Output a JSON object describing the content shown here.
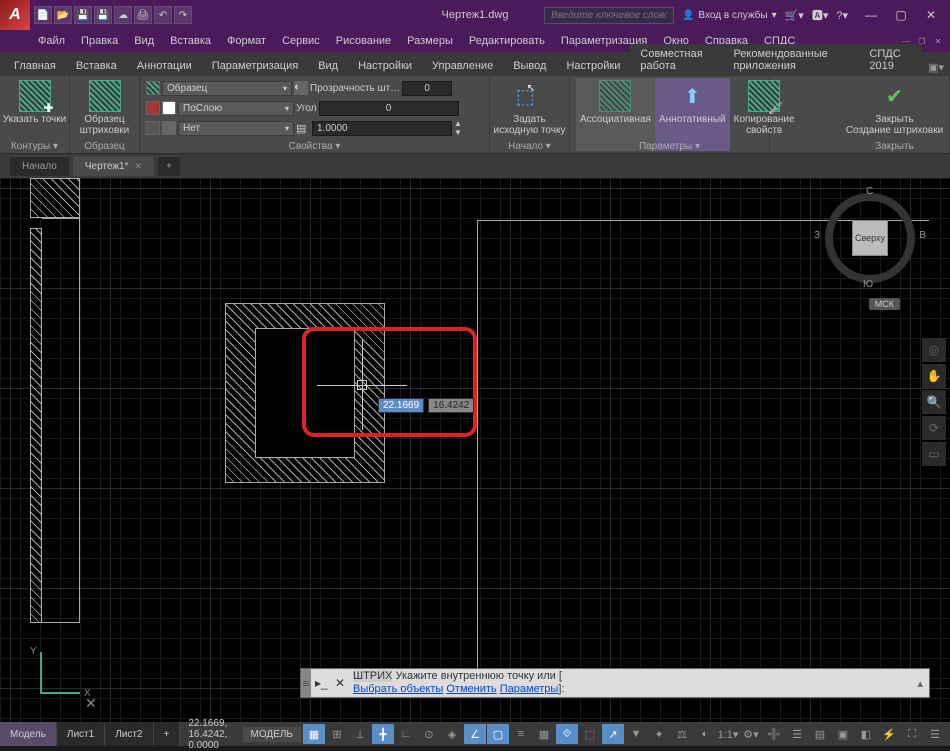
{
  "title": "Чертеж1.dwg",
  "search_placeholder": "Введите ключевое слово/фразу",
  "signin": "Вход в службы",
  "menu": [
    "Файл",
    "Правка",
    "Вид",
    "Вставка",
    "Формат",
    "Сервис",
    "Рисование",
    "Размеры",
    "Редактировать",
    "Параметризация",
    "Окно",
    "Справка",
    "СПДС"
  ],
  "ribbon_tabs": [
    "Главная",
    "Вставка",
    "Аннотации",
    "Параметризация",
    "Вид",
    "Настройки",
    "Управление",
    "Вывод",
    "Настройки",
    "Совместная работа",
    "Рекомендованные приложения",
    "СПДС 2019"
  ],
  "ribbon": {
    "contours": {
      "label": "Контуры ▾",
      "btn": "Указать точки"
    },
    "pattern": {
      "label": "Образец",
      "btn": "Образец\nштриховки"
    },
    "props": {
      "label": "Свойства ▾",
      "pattern": "Образец",
      "bylayer": "ПоСлою",
      "none": "Нет",
      "transp": "Прозрачность шт…",
      "transp_val": "0",
      "angle": "Угол",
      "angle_val": "0",
      "scale_val": "1.0000"
    },
    "origin": {
      "label": "Начало ▾",
      "btn": "Задать\nисходную точку"
    },
    "options": {
      "label": "Параметры ▾",
      "assoc": "Ассоциативная",
      "annot": "Аннотативный",
      "match": "Копирование\nсвойств"
    },
    "close": {
      "label": "Закрыть",
      "btn": "Закрыть\nСоздание штриховки"
    }
  },
  "filetabs": {
    "start": "Начало",
    "current": "Чертеж1*"
  },
  "cursor": {
    "x": "22.1669",
    "y": "16.4242"
  },
  "viewcube": {
    "face": "Сверху",
    "n": "С",
    "s": "Ю",
    "e": "В",
    "w": "З",
    "ucs": "МСК"
  },
  "command": {
    "name": "ШТРИХ",
    "prompt": "Укажите внутреннюю точку или [",
    "opts": [
      "Выбрать объекты",
      "Отменить",
      "Параметры"
    ],
    "close": "]:"
  },
  "status": {
    "tabs": [
      "Модель",
      "Лист1",
      "Лист2"
    ],
    "coords": "22.1669, 16.4242, 0.0000",
    "model": "МОДЕЛЬ"
  },
  "ucs_labels": {
    "x": "X",
    "y": "Y"
  }
}
